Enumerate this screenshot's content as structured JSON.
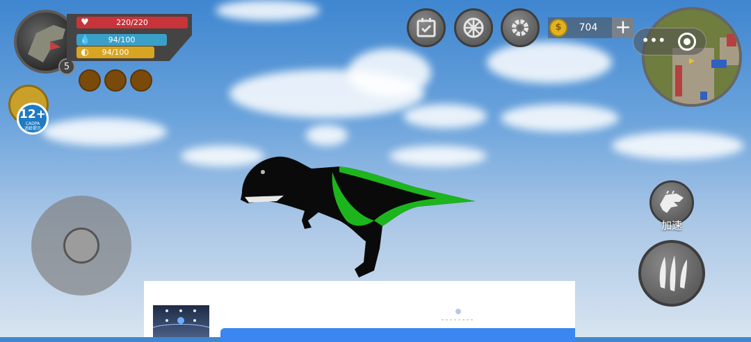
{
  "player": {
    "health": "220/220",
    "water": "94/100",
    "hunger": "94/100",
    "level": "5",
    "health_color": "#c8343a",
    "water_color": "#3aa0c8",
    "hunger_color": "#d8a520"
  },
  "age_rating": {
    "label": "12+",
    "org": "CADPA",
    "note": "适龄提示"
  },
  "icons": {
    "tasks": "calendar-check-icon",
    "wheel": "wheel-icon",
    "settings": "gear-icon",
    "coin": "coin-icon",
    "add": "plus-icon"
  },
  "currency": {
    "coins": "704"
  },
  "controls": {
    "sprint_label": "加速"
  }
}
